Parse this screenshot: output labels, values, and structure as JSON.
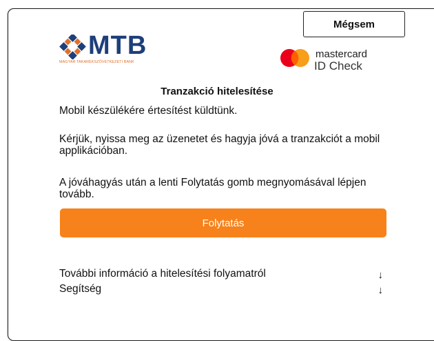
{
  "header": {
    "cancel_label": "Mégsem",
    "bank_logo": {
      "word": "MTB",
      "subtitle": "MAGYAR TAKARÉKSZÖVETKEZETI BANK",
      "icon": "mtb-diamond-logo-icon",
      "brand_colors": {
        "navy": "#1d3f7a",
        "orange": "#e0702a"
      }
    },
    "card_logo": {
      "brand": "mastercard",
      "product": "ID Check",
      "colors": {
        "red": "#eb001b",
        "yellow": "#f79e1b",
        "overlap": "#ff5f00"
      }
    }
  },
  "main": {
    "title": "Tranzakció hitelesítése",
    "paragraph1": "Mobil készülékére értesítést küldtünk.",
    "paragraph2": "Kérjük, nyissa meg az üzenetet és hagyja jóvá a tranzakciót a mobil applikációban.",
    "paragraph3": "A jóváhagyás után a lenti Folytatás gomb megnyomásával lépjen tovább.",
    "continue_label": "Folytatás",
    "accent_color": "#f7821b"
  },
  "footer": {
    "links": [
      {
        "label": "További információ a hitelesítési folyamatról",
        "icon": "↓"
      },
      {
        "label": "Segítség",
        "icon": "↓"
      }
    ]
  }
}
